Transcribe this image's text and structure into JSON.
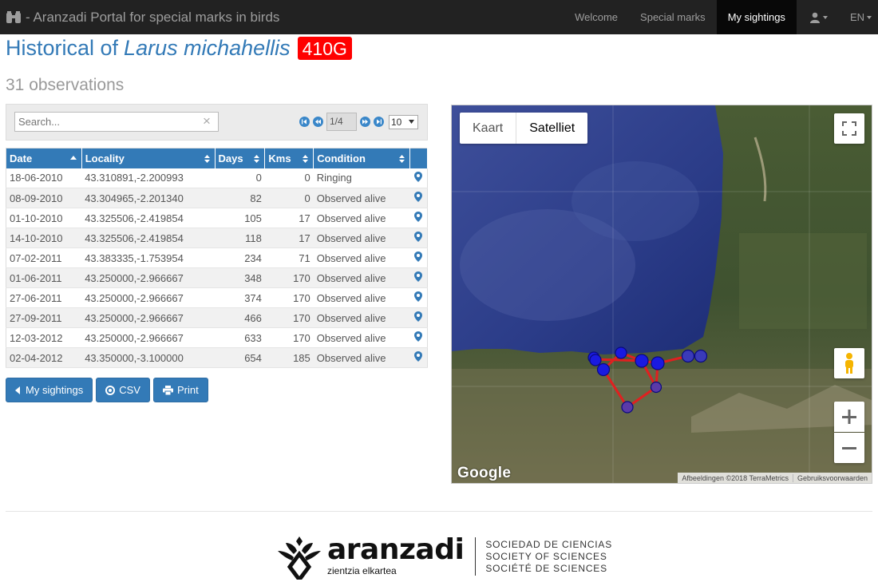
{
  "navbar": {
    "brand": "- Aranzadi Portal for special marks in birds",
    "items": [
      {
        "label": "Welcome",
        "active": false
      },
      {
        "label": "Special marks",
        "active": false
      },
      {
        "label": "My sightings",
        "active": true
      }
    ],
    "lang": "EN"
  },
  "page": {
    "title_prefix": "Historical of",
    "species": "Larus michahellis",
    "mark": "410G",
    "observations": "31 observations"
  },
  "toolbar": {
    "search_placeholder": "Search...",
    "page_display": "1/4",
    "page_size": "10"
  },
  "table": {
    "columns": [
      "Date",
      "Locality",
      "Days",
      "Kms",
      "Condition"
    ],
    "rows": [
      [
        "18-06-2010",
        "43.310891,-2.200993",
        "0",
        "0",
        "Ringing"
      ],
      [
        "08-09-2010",
        "43.304965,-2.201340",
        "82",
        "0",
        "Observed alive"
      ],
      [
        "01-10-2010",
        "43.325506,-2.419854",
        "105",
        "17",
        "Observed alive"
      ],
      [
        "14-10-2010",
        "43.325506,-2.419854",
        "118",
        "17",
        "Observed alive"
      ],
      [
        "07-02-2011",
        "43.383335,-1.753954",
        "234",
        "71",
        "Observed alive"
      ],
      [
        "01-06-2011",
        "43.250000,-2.966667",
        "348",
        "170",
        "Observed alive"
      ],
      [
        "27-06-2011",
        "43.250000,-2.966667",
        "374",
        "170",
        "Observed alive"
      ],
      [
        "27-09-2011",
        "43.250000,-2.966667",
        "466",
        "170",
        "Observed alive"
      ],
      [
        "12-03-2012",
        "43.250000,-2.966667",
        "633",
        "170",
        "Observed alive"
      ],
      [
        "02-04-2012",
        "43.350000,-3.100000",
        "654",
        "185",
        "Observed alive"
      ]
    ]
  },
  "buttons": {
    "sightings": "My sightings",
    "csv": "CSV",
    "print": "Print"
  },
  "map": {
    "type_map": "Kaart",
    "type_satellite": "Satelliet",
    "logo": "Google",
    "imagery": "Afbeeldingen ©2018 TerraMetrics",
    "terms": "Gebruiksvoorwaarden"
  },
  "footer": {
    "name": "aranzadi",
    "subname": "zientzia elkartea",
    "tag1": "SOCIEDAD DE CIENCIAS",
    "tag2": "SOCIETY OF SCIENCES",
    "tag3": "SOCIÉTÉ DE SCIENCES"
  },
  "colors": {
    "navbar": "#222222",
    "primary": "#337ab7",
    "mark_badge": "#ff0000",
    "track": "#e02020",
    "point": "#1a1ae0"
  }
}
